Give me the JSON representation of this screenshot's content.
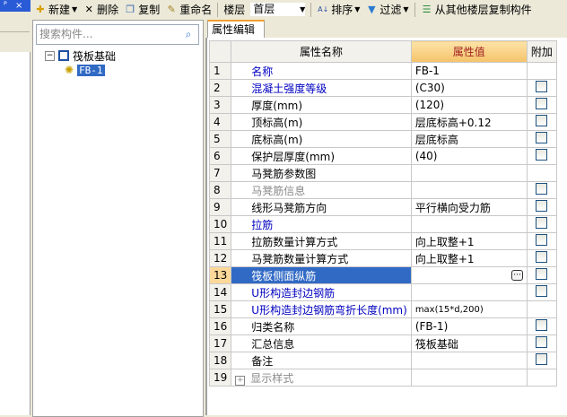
{
  "left_panel": {
    "pin": "ᴾ",
    "close": "×"
  },
  "toolbar": {
    "new": "新建",
    "delete": "删除",
    "copy": "复制",
    "rename": "重命名",
    "floor_label": "楼层",
    "floor_value": "首层",
    "sort": "排序",
    "filter": "过滤",
    "copy_from_floor": "从其他楼层复制构件"
  },
  "search": {
    "placeholder": "搜索构件..."
  },
  "tree": {
    "root": "筏板基础",
    "child": "FB-1"
  },
  "tab": "属性编辑",
  "table": {
    "headers": [
      "",
      "属性名称",
      "属性值",
      "附加"
    ],
    "rows": [
      {
        "n": "1",
        "name": "名称",
        "value": "FB-1",
        "check": false,
        "style": "blue"
      },
      {
        "n": "2",
        "name": "混凝土强度等级",
        "value": "(C30)",
        "check": true,
        "style": "blue"
      },
      {
        "n": "3",
        "name": "厚度(mm)",
        "value": "(120)",
        "check": true,
        "style": ""
      },
      {
        "n": "4",
        "name": "顶标高(m)",
        "value": "层底标高+0.12",
        "check": true,
        "style": ""
      },
      {
        "n": "5",
        "name": "底标高(m)",
        "value": "层底标高",
        "check": true,
        "style": ""
      },
      {
        "n": "6",
        "name": "保护层厚度(mm)",
        "value": "(40)",
        "check": true,
        "style": ""
      },
      {
        "n": "7",
        "name": "马凳筋参数图",
        "value": "",
        "check": false,
        "style": ""
      },
      {
        "n": "8",
        "name": "马凳筋信息",
        "value": "",
        "check": true,
        "style": "gray"
      },
      {
        "n": "9",
        "name": "线形马凳筋方向",
        "value": "平行横向受力筋",
        "check": true,
        "style": ""
      },
      {
        "n": "10",
        "name": "拉筋",
        "value": "",
        "check": true,
        "style": "blue"
      },
      {
        "n": "11",
        "name": "拉筋数量计算方式",
        "value": "向上取整+1",
        "check": true,
        "style": ""
      },
      {
        "n": "12",
        "name": "马凳筋数量计算方式",
        "value": "向上取整+1",
        "check": true,
        "style": ""
      },
      {
        "n": "13",
        "name": "筏板侧面纵筋",
        "value": "",
        "check": true,
        "style": "sel"
      },
      {
        "n": "14",
        "name": "U形构造封边钢筋",
        "value": "",
        "check": true,
        "style": "blue"
      },
      {
        "n": "15",
        "name": "U形构造封边钢筋弯折长度(mm)",
        "value": "max(15*d,200)",
        "check": false,
        "style": "blue"
      },
      {
        "n": "16",
        "name": "归类名称",
        "value": "(FB-1)",
        "check": true,
        "style": ""
      },
      {
        "n": "17",
        "name": "汇总信息",
        "value": "筏板基础",
        "check": true,
        "style": ""
      },
      {
        "n": "18",
        "name": "备注",
        "value": "",
        "check": true,
        "style": ""
      },
      {
        "n": "19",
        "name": "显示样式",
        "value": "",
        "check": false,
        "style": "gray",
        "expand": "+"
      }
    ],
    "ellipsis": "···"
  }
}
